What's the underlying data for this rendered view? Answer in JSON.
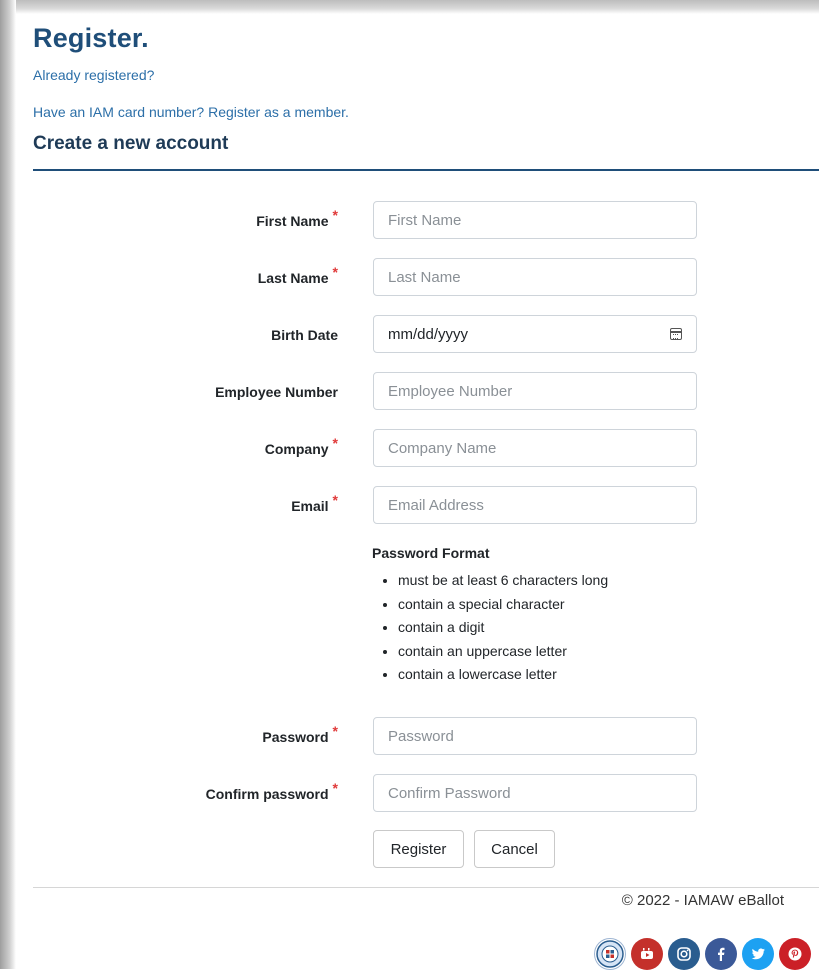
{
  "header": {
    "title": "Register.",
    "already_registered": "Already registered?",
    "member_link": "Have an IAM card number? Register as a member.",
    "subtitle": "Create a new account"
  },
  "form": {
    "first_name": {
      "label": "First Name",
      "required_mark": "*",
      "placeholder": "First Name",
      "value": ""
    },
    "last_name": {
      "label": "Last Name",
      "required_mark": "*",
      "placeholder": "Last Name",
      "value": ""
    },
    "birth_date": {
      "label": "Birth Date",
      "placeholder": "mm/dd/yyyy"
    },
    "employee_number": {
      "label": "Employee Number",
      "placeholder": "Employee Number",
      "value": ""
    },
    "company": {
      "label": "Company",
      "required_mark": "*",
      "placeholder": "Company Name",
      "value": ""
    },
    "email": {
      "label": "Email",
      "required_mark": "*",
      "placeholder": "Email Address",
      "value": ""
    },
    "password_format": {
      "title": "Password Format",
      "rules": [
        "must be at least 6 characters long",
        "contain a special character",
        "contain a digit",
        "contain an uppercase letter",
        "contain a lowercase letter"
      ]
    },
    "password": {
      "label": "Password",
      "required_mark": "*",
      "placeholder": "Password",
      "value": ""
    },
    "confirm_password": {
      "label": "Confirm password",
      "required_mark": "*",
      "placeholder": "Confirm Password",
      "value": ""
    }
  },
  "buttons": {
    "register": "Register",
    "cancel": "Cancel"
  },
  "footer": {
    "copyright": "© 2022 - IAMAW eBallot",
    "social_icons": [
      "iam-seal-icon",
      "youtube-icon",
      "instagram-icon",
      "facebook-icon",
      "twitter-icon",
      "pinterest-icon"
    ]
  },
  "colors": {
    "title": "#1f4e79",
    "link": "#2c6fa8",
    "required": "#e03a3a",
    "youtube": "#c4302b",
    "instagram": "#2a5d8f",
    "facebook": "#3b5998",
    "twitter": "#1da1f2",
    "pinterest": "#cb2027"
  }
}
